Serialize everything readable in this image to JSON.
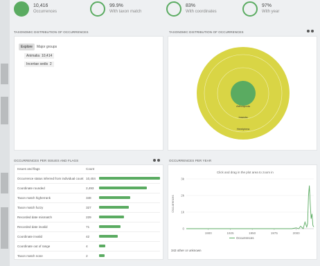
{
  "stats": [
    {
      "value": "10,416",
      "label": "Occurrences",
      "filled": true
    },
    {
      "value": "99.9%",
      "label": "With taxon match",
      "filled": false
    },
    {
      "value": "83%",
      "label": "With coordinates",
      "filled": false
    },
    {
      "value": "97%",
      "label": "With year",
      "filled": false
    }
  ],
  "taxonomic_panel": {
    "title": "Taxonomic distribution of occurrences",
    "tabs": [
      "Explore",
      "Major groups"
    ],
    "items": [
      {
        "label": "Animalia",
        "count": "10,414"
      },
      {
        "label": "Incertae sedis",
        "count": "2"
      }
    ]
  },
  "sunburst_panel": {
    "title": "Taxonomic distribution of occurrences",
    "labels": [
      "Arthropoda",
      "Insecta",
      "Hemiptera"
    ],
    "colors": {
      "inner": "#5aab61",
      "outer": "#d9d545"
    }
  },
  "issues_panel": {
    "title": "Occurrences per issues and flags",
    "col_issue": "Issues and flags",
    "col_count": "Count",
    "rows": [
      {
        "label": "Occurrence status inferred from individual count",
        "count": "10,404",
        "value": 10404
      },
      {
        "label": "Coordinate rounded",
        "count": "2,493",
        "value": 8100
      },
      {
        "label": "Taxon match higherrank",
        "count": "348",
        "value": 5300
      },
      {
        "label": "Taxon match fuzzy",
        "count": "327",
        "value": 5100
      },
      {
        "label": "Recorded date mismatch",
        "count": "229",
        "value": 4300
      },
      {
        "label": "Recorded date invalid",
        "count": "71",
        "value": 3700
      },
      {
        "label": "Coordinate invalid",
        "count": "42",
        "value": 3200
      },
      {
        "label": "Coordinate out of range",
        "count": "4",
        "value": 1100
      },
      {
        "label": "Taxon match none",
        "count": "2",
        "value": 900
      }
    ]
  },
  "year_panel": {
    "title": "Occurrences per year",
    "hint": "Click and drag in the plot area to zoom in",
    "legend": "Occurrences",
    "footnote": "343 other or unknown"
  },
  "chart_data": {
    "type": "line",
    "title": "",
    "xlabel": "",
    "ylabel": "Occurrences",
    "x_ticks": [
      "1900",
      "1925",
      "1950",
      "1975",
      "2000"
    ],
    "y_ticks": [
      "0",
      "1k",
      "2k",
      "3k"
    ],
    "ylim": [
      0,
      3000
    ],
    "xlim": [
      1875,
      2020
    ],
    "series": [
      {
        "name": "Occurrences",
        "x": [
          1875,
          1990,
          1995,
          2000,
          2003,
          2005,
          2008,
          2010,
          2012,
          2013,
          2014,
          2015,
          2016,
          2017,
          2018,
          2019,
          2020
        ],
        "y": [
          0,
          0,
          0,
          50,
          0,
          150,
          0,
          400,
          100,
          300,
          2000,
          2600,
          1500,
          600,
          900,
          200,
          100
        ]
      }
    ]
  }
}
